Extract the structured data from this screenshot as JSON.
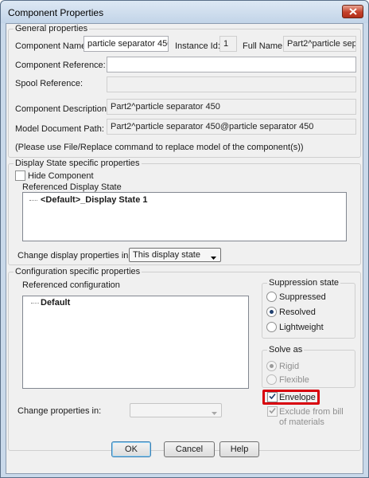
{
  "window": {
    "title": "Component Properties"
  },
  "general": {
    "legend": "General properties",
    "component_name_label": "Component Name:",
    "component_name_value": "particle separator 450",
    "instance_id_label": "Instance Id:",
    "instance_id_value": "1",
    "full_name_label": "Full Name:",
    "full_name_value": "Part2^particle sep",
    "component_reference_label": "Component Reference:",
    "component_reference_value": "",
    "spool_reference_label": "Spool Reference:",
    "spool_reference_value": "",
    "component_description_label": "Component Description:",
    "component_description_value": "Part2^particle separator 450",
    "model_document_path_label": "Model Document Path:",
    "model_document_path_value": "Part2^particle separator 450@particle separator 450",
    "replace_note": "(Please use File/Replace command to replace model of the component(s))"
  },
  "display_state": {
    "legend": "Display State specific properties",
    "hide_component_label": "Hide Component",
    "hide_component_checked": false,
    "referenced_label": "Referenced Display State",
    "items": [
      "<Default>_Display State 1"
    ],
    "change_in_label": "Change display properties in:",
    "change_in_value": "This display state"
  },
  "configuration": {
    "legend": "Configuration specific properties",
    "referenced_label": "Referenced configuration",
    "items": [
      "Default"
    ],
    "change_in_label": "Change properties in:",
    "change_in_value": ""
  },
  "suppression": {
    "legend": "Suppression state",
    "options": [
      "Suppressed",
      "Resolved",
      "Lightweight"
    ],
    "selected": "Resolved"
  },
  "solve_as": {
    "legend": "Solve as",
    "options": [
      "Rigid",
      "Flexible"
    ],
    "selected": "Rigid",
    "disabled": true
  },
  "envelope": {
    "label": "Envelope",
    "checked": true
  },
  "exclude_bom": {
    "label_line1": "Exclude from bill",
    "label_line2": "of materials",
    "checked": true,
    "disabled": true
  },
  "buttons": {
    "ok": "OK",
    "cancel": "Cancel",
    "help": "Help"
  },
  "colors": {
    "highlight": "#d8000c",
    "title_bar": "#c9d9ea",
    "close_button": "#c4402a"
  },
  "icons": {
    "close": "close-x-icon",
    "dropdown": "chevron-down-icon",
    "check": "checkmark-icon"
  }
}
